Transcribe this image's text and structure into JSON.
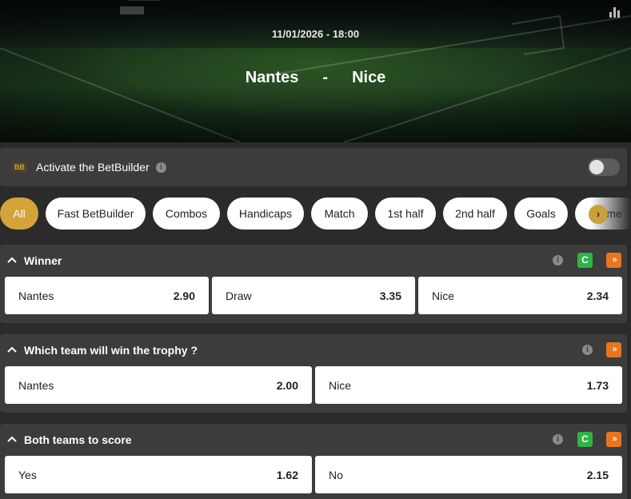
{
  "match": {
    "datetime": "11/01/2026 - 18:00",
    "home": "Nantes",
    "separator": "-",
    "away": "Nice"
  },
  "betbuilder": {
    "badge": "BB",
    "label": "Activate the BetBuilder",
    "enabled": false
  },
  "filters": {
    "items": [
      "All",
      "Fast BetBuilder",
      "Combos",
      "Handicaps",
      "Match",
      "1st half",
      "2nd half",
      "Goals",
      "Home"
    ],
    "active": "All"
  },
  "markets": [
    {
      "title": "Winner",
      "cashout": true,
      "outcomes": [
        {
          "label": "Nantes",
          "odds": "2.90"
        },
        {
          "label": "Draw",
          "odds": "3.35"
        },
        {
          "label": "Nice",
          "odds": "2.34"
        }
      ]
    },
    {
      "title": "Which team will win the trophy ?",
      "cashout": false,
      "outcomes": [
        {
          "label": "Nantes",
          "odds": "2.00"
        },
        {
          "label": "Nice",
          "odds": "1.73"
        }
      ]
    },
    {
      "title": "Both teams to score",
      "cashout": true,
      "outcomes": [
        {
          "label": "Yes",
          "odds": "1.62"
        },
        {
          "label": "No",
          "odds": "2.15"
        }
      ]
    }
  ],
  "colors": {
    "accent": "#d3a43a",
    "cashout": "#2fb344",
    "boost": "#e8761f",
    "panel": "#3c3c3c",
    "background": "#2b2b2b"
  }
}
